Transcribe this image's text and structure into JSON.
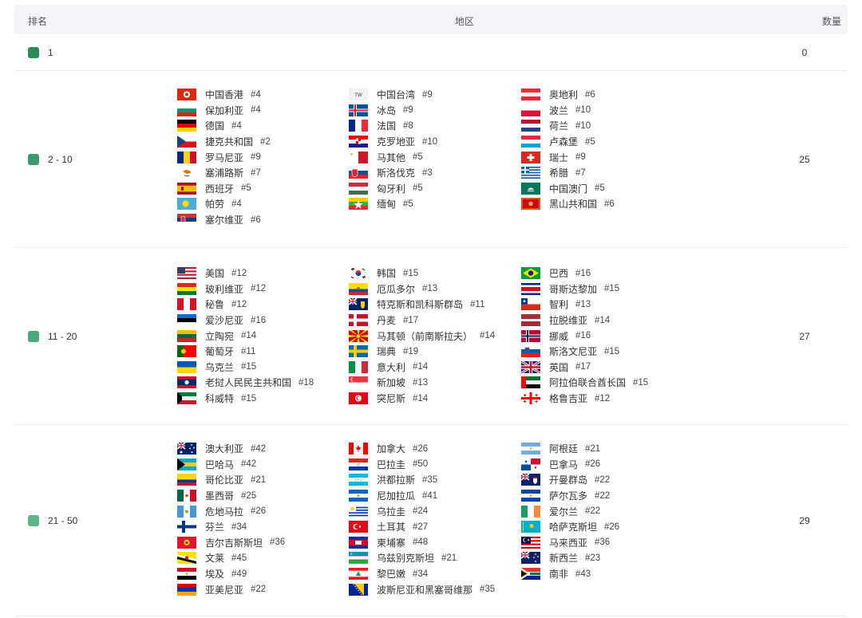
{
  "header": {
    "rank": "排名",
    "region": "地区",
    "count": "数量"
  },
  "groups": [
    {
      "rank": "1",
      "count": "0",
      "color": "#2e8b57",
      "columns": [
        [],
        [],
        []
      ]
    },
    {
      "rank": "2 - 10",
      "count": "25",
      "color": "#3c9a69",
      "columns": [
        [
          [
            "中国香港",
            "#4",
            "hk"
          ],
          [
            "保加利亚",
            "#4",
            "bg"
          ],
          [
            "德国",
            "#4",
            "de"
          ],
          [
            "捷克共和国",
            "#2",
            "cz"
          ],
          [
            "罗马尼亚",
            "#9",
            "ro"
          ],
          [
            "塞浦路斯",
            "#7",
            "cy"
          ],
          [
            "西班牙",
            "#5",
            "es"
          ],
          [
            "帕劳",
            "#4",
            "pw"
          ],
          [
            "塞尔维亚",
            "#6",
            "rs"
          ]
        ],
        [
          [
            "中国台湾",
            "#9",
            "tw"
          ],
          [
            "冰岛",
            "#9",
            "is"
          ],
          [
            "法国",
            "#8",
            "fr"
          ],
          [
            "克罗地亚",
            "#10",
            "hr"
          ],
          [
            "马其他",
            "#5",
            "mt"
          ],
          [
            "斯洛伐克",
            "#3",
            "sk"
          ],
          [
            "匈牙利",
            "#5",
            "hu"
          ],
          [
            "缅甸",
            "#5",
            "mm"
          ]
        ],
        [
          [
            "奥地利",
            "#6",
            "at"
          ],
          [
            "波兰",
            "#10",
            "pl"
          ],
          [
            "荷兰",
            "#10",
            "nl"
          ],
          [
            "卢森堡",
            "#5",
            "lu"
          ],
          [
            "瑞士",
            "#9",
            "ch"
          ],
          [
            "希腊",
            "#7",
            "gr"
          ],
          [
            "中国澳门",
            "#5",
            "mo"
          ],
          [
            "黑山共和国",
            "#6",
            "me"
          ]
        ]
      ]
    },
    {
      "rank": "11 - 20",
      "count": "27",
      "color": "#4aa87a",
      "columns": [
        [
          [
            "美国",
            "#12",
            "us"
          ],
          [
            "玻利维亚",
            "#12",
            "bo"
          ],
          [
            "秘鲁",
            "#12",
            "pe"
          ],
          [
            "爱沙尼亚",
            "#16",
            "ee"
          ],
          [
            "立陶宛",
            "#14",
            "lt"
          ],
          [
            "葡萄牙",
            "#11",
            "pt"
          ],
          [
            "乌克兰",
            "#15",
            "ua"
          ],
          [
            "老挝人民民主共和国",
            "#18",
            "la"
          ],
          [
            "科威特",
            "#15",
            "kw"
          ]
        ],
        [
          [
            "韩国",
            "#15",
            "kr"
          ],
          [
            "厄瓜多尔",
            "#13",
            "ec"
          ],
          [
            "特克斯和凯科斯群岛",
            "#11",
            "tc"
          ],
          [
            "丹麦",
            "#17",
            "dk"
          ],
          [
            "马其顿（前南斯拉夫）",
            "#14",
            "mk"
          ],
          [
            "瑞典",
            "#19",
            "se"
          ],
          [
            "意大利",
            "#14",
            "it"
          ],
          [
            "新加坡",
            "#13",
            "sg"
          ],
          [
            "突尼斯",
            "#14",
            "tn"
          ]
        ],
        [
          [
            "巴西",
            "#16",
            "br"
          ],
          [
            "哥斯达黎加",
            "#15",
            "cr"
          ],
          [
            "智利",
            "#13",
            "cl"
          ],
          [
            "拉脱维亚",
            "#14",
            "lv"
          ],
          [
            "挪威",
            "#16",
            "no"
          ],
          [
            "斯洛文尼亚",
            "#15",
            "si"
          ],
          [
            "英国",
            "#17",
            "gb"
          ],
          [
            "阿拉伯联合酋长国",
            "#15",
            "ae"
          ],
          [
            "格鲁吉亚",
            "#12",
            "ge"
          ]
        ]
      ]
    },
    {
      "rank": "21 - 50",
      "count": "29",
      "color": "#5bb688",
      "columns": [
        [
          [
            "澳大利亚",
            "#42",
            "au"
          ],
          [
            "巴哈马",
            "#42",
            "bs"
          ],
          [
            "哥伦比亚",
            "#21",
            "co"
          ],
          [
            "墨西哥",
            "#25",
            "mx"
          ],
          [
            "危地马拉",
            "#26",
            "gt"
          ],
          [
            "芬兰",
            "#34",
            "fi"
          ],
          [
            "吉尔吉斯斯坦",
            "#36",
            "kg"
          ],
          [
            "文莱",
            "#45",
            "bn"
          ],
          [
            "埃及",
            "#49",
            "eg"
          ],
          [
            "亚美尼亚",
            "#22",
            "am"
          ]
        ],
        [
          [
            "加拿大",
            "#26",
            "ca"
          ],
          [
            "巴拉圭",
            "#50",
            "py"
          ],
          [
            "洪都拉斯",
            "#35",
            "hn"
          ],
          [
            "尼加拉瓜",
            "#41",
            "ni"
          ],
          [
            "乌拉圭",
            "#24",
            "uy"
          ],
          [
            "土耳其",
            "#27",
            "tr"
          ],
          [
            "柬埔寨",
            "#48",
            "kh"
          ],
          [
            "乌兹别克斯坦",
            "#21",
            "uz"
          ],
          [
            "黎巴嫩",
            "#34",
            "lb"
          ],
          [
            "波斯尼亚和黑塞哥维那",
            "#35",
            "ba"
          ]
        ],
        [
          [
            "阿根廷",
            "#21",
            "ar"
          ],
          [
            "巴拿马",
            "#26",
            "pa"
          ],
          [
            "开曼群岛",
            "#22",
            "ky"
          ],
          [
            "萨尔瓦多",
            "#22",
            "sv"
          ],
          [
            "爱尔兰",
            "#22",
            "ie"
          ],
          [
            "哈萨克斯坦",
            "#26",
            "kz"
          ],
          [
            "马来西亚",
            "#36",
            "my"
          ],
          [
            "新西兰",
            "#23",
            "nz"
          ],
          [
            "南非",
            "#43",
            "za"
          ]
        ]
      ]
    }
  ]
}
